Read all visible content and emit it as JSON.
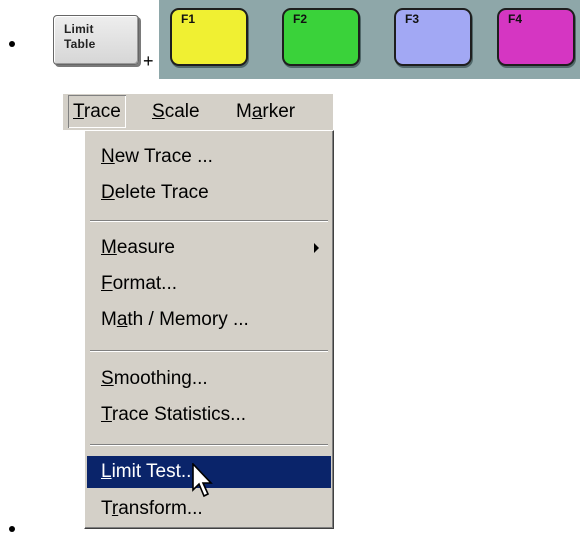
{
  "toolbar": {
    "limit_table_button": {
      "line1": "Limit",
      "line2": "Table"
    },
    "plus": "+"
  },
  "function_keys": [
    {
      "label": "F1",
      "color": "#f0f032"
    },
    {
      "label": "F2",
      "color": "#3ad23a"
    },
    {
      "label": "F3",
      "color": "#a2a8f4"
    },
    {
      "label": "F4",
      "color": "#d536c2"
    }
  ],
  "menubar": {
    "items": [
      {
        "label": "Trace",
        "active": true
      },
      {
        "label": "Scale",
        "active": false
      },
      {
        "label": "Marker",
        "active": false
      }
    ]
  },
  "trace_menu": {
    "items": [
      {
        "label": "New Trace ..."
      },
      {
        "label": "Delete Trace"
      },
      {
        "label": "Measure",
        "has_submenu": true
      },
      {
        "label": "Format..."
      },
      {
        "label": "Math / Memory ..."
      },
      {
        "label": "Smoothing..."
      },
      {
        "label": "Trace Statistics..."
      },
      {
        "label": "Limit Test...",
        "highlighted": true
      },
      {
        "label": "Transform..."
      }
    ]
  },
  "colors": {
    "fkey_strip": "#8ea7a9",
    "menu_background": "#d4d0c8",
    "highlight": "#0a246a"
  },
  "icons": {
    "pointer": "mouse-pointer-icon",
    "submenu": "submenu-arrow-icon"
  }
}
